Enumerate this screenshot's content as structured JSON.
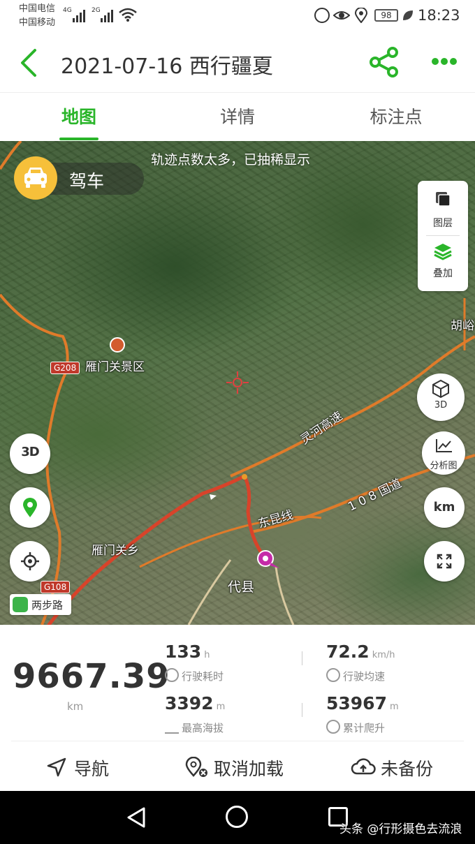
{
  "status_bar": {
    "carrier_1": "中国电信",
    "carrier_2": "中国移动",
    "signal_1": "4G",
    "signal_2": "2G",
    "battery": "98",
    "time": "18:23",
    "icons": [
      "signal-icon",
      "wifi-icon",
      "volte-icon",
      "eye-comfort-icon",
      "location-icon",
      "battery-icon",
      "leaf-icon"
    ]
  },
  "header": {
    "title": "2021-07-16 西行疆夏",
    "icons": [
      "back-icon",
      "share-icon",
      "more-icon"
    ],
    "accent_color": "#2ab52a"
  },
  "tabs": [
    {
      "label": "地图",
      "active": true
    },
    {
      "label": "详情",
      "active": false
    },
    {
      "label": "标注点",
      "active": false
    }
  ],
  "map": {
    "banner": "轨迹点数太多，已抽稀显示",
    "mode": "驾车",
    "layers_label": "图层",
    "overlay_label": "叠加",
    "btn_3d_label": "3D",
    "btn_analysis_label": "分析图",
    "btn_km_label": "km",
    "left_btn_3d_label": "3D",
    "track_color": "#d8432a",
    "labels": {
      "scenic": "雁门关景区",
      "g208": "G208",
      "g108": "G108",
      "linghe": "灵河高速",
      "national_road": "1 0 8 国道",
      "dongyu": "东昆线",
      "yanmenguan": "雁门关乡",
      "daixian": "代县",
      "huling": "胡峪",
      "step": "两步路"
    }
  },
  "stats": {
    "total_distance": "9667.39",
    "total_unit": "km",
    "items": [
      {
        "value": "133",
        "unit": "h",
        "label": "行驶耗时",
        "icon": "clock-icon"
      },
      {
        "value": "72.2",
        "unit": "km/h",
        "label": "行驶均速",
        "icon": "speed-icon"
      },
      {
        "value": "3392",
        "unit": "m",
        "label": "最高海拔",
        "icon": "altitude-icon"
      },
      {
        "value": "53967",
        "unit": "m",
        "label": "累计爬升",
        "icon": "climb-icon"
      }
    ]
  },
  "actions": [
    {
      "label": "导航",
      "icon": "navigate-icon"
    },
    {
      "label": "取消加载",
      "icon": "unload-icon"
    },
    {
      "label": "未备份",
      "icon": "cloud-upload-icon"
    }
  ],
  "watermark": "头条 @行形摄色去流浪"
}
